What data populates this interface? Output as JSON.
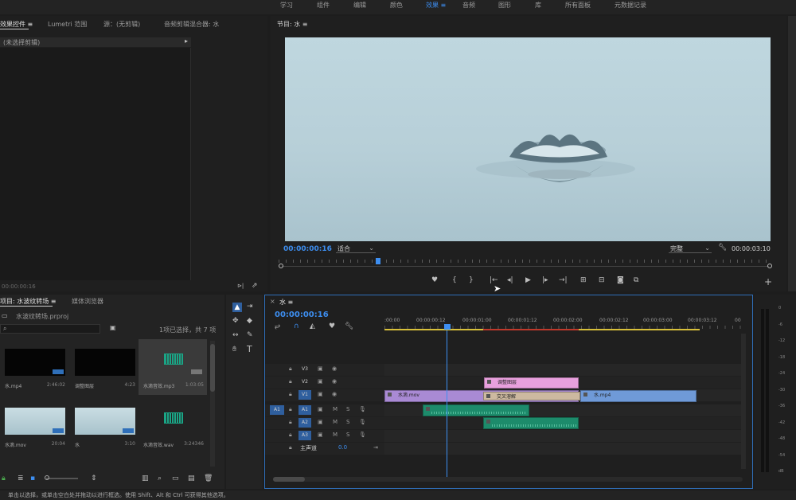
{
  "workspaces": [
    {
      "label": "学习",
      "active": false
    },
    {
      "label": "组件",
      "active": false
    },
    {
      "label": "编辑",
      "active": false
    },
    {
      "label": "颜色",
      "active": false
    },
    {
      "label": "效果",
      "active": true
    },
    {
      "label": "音频",
      "active": false
    },
    {
      "label": "图形",
      "active": false
    },
    {
      "label": "库",
      "active": false
    },
    {
      "label": "所有面板",
      "active": false
    },
    {
      "label": "元数据记录",
      "active": false
    }
  ],
  "top_left": {
    "tabs": [
      "效果控件",
      "Lumetri 范围",
      "源：(无剪辑)",
      "音频剪辑混合器: 水"
    ],
    "no_clip": "(未选择剪辑)",
    "timecode": "00:00:00:16"
  },
  "program": {
    "title": "节目: 水",
    "timecode": "00:00:00:16",
    "zoom": "适合",
    "quality": "完整",
    "duration": "00:00:03:10",
    "playhead_fraction": 0.196
  },
  "project": {
    "tabs": [
      "项目: 水波纹转场",
      "媒体浏览器"
    ],
    "filename": "水波纹转场.prproj",
    "selection": "1项已选择，共 7 项",
    "items": [
      {
        "name": "水.mp4",
        "duration": "2:46:02",
        "thumb": "black",
        "badge": true
      },
      {
        "name": "调整图层",
        "duration": "4:23",
        "thumb": "black",
        "badge": false
      },
      {
        "name": "水滴音效.mp3",
        "duration": "1:03:05",
        "thumb": "audio",
        "badge": true,
        "selected": true
      },
      {
        "name": "水滴.mov",
        "duration": "20:04",
        "thumb": "water",
        "badge": true
      },
      {
        "name": "水",
        "duration": "3:10",
        "thumb": "water",
        "badge": true
      },
      {
        "name": "水滴音效.wav",
        "duration": "3:24346",
        "thumb": "audio",
        "badge": false
      }
    ]
  },
  "timeline": {
    "sequence": "水",
    "timecode": "00:00:00:16",
    "ruler": [
      ":00:00",
      "00:00:00:12",
      "00:00:01:00",
      "00:00:01:12",
      "00:00:02:00",
      "00:00:02:12",
      "00:00:03:00",
      "00:00:03:12",
      "00"
    ],
    "video_tracks": [
      "V3",
      "V2",
      "V1"
    ],
    "audio_tracks": [
      "A1",
      "A2",
      "A3"
    ],
    "src_patch": "A1",
    "master": {
      "label": "主声道",
      "value": "0.0"
    },
    "track_btns": {
      "m": "M",
      "s": "S"
    },
    "clips": {
      "adjust": "调整图层",
      "mov": "水滴.mov",
      "cross": "交叉溶解",
      "mp4": "水.mp4"
    }
  },
  "meter_labels": [
    "0",
    "-6",
    "-12",
    "-18",
    "-24",
    "-30",
    "-36",
    "-42",
    "-48",
    "-54",
    "dB"
  ],
  "status": "单击以选择，或单击空白处并拖动以进行框选。使用 Shift、Alt 和 Ctrl 可获得其他选项。",
  "colors": {
    "accent": "#3d8ef0",
    "audio_clip": "#1d8b6b",
    "video_clip": "#a98ad4",
    "adjust_clip": "#e8a0dd",
    "mp4_clip": "#6f9ad8"
  }
}
